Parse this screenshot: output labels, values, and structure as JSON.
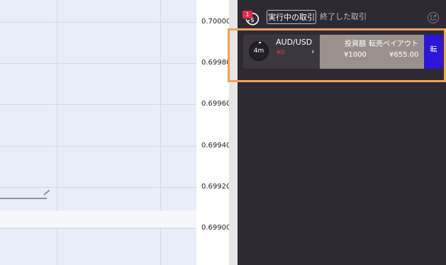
{
  "chart": {
    "price_ticks": [
      "0.70000",
      "0.69980",
      "0.69960",
      "0.69940",
      "0.69920",
      "0.69900"
    ]
  },
  "panel": {
    "badge_count": "1",
    "tab_active": "実行中の取引",
    "tab_closed": "終了した取引",
    "trade": {
      "timer": "4m",
      "pair": "AUD/USD",
      "pnl": "¥0",
      "investment_label": "投資額",
      "payout_label": "転売ペイアウト",
      "investment_value": "¥1000",
      "payout_value": "¥655.00",
      "sell_label": "転"
    }
  },
  "colors": {
    "accent_blue": "#2c16d8",
    "loss_red": "#e0374d",
    "highlight_orange": "#f0a35a",
    "panel_bg": "#2e2a33"
  }
}
